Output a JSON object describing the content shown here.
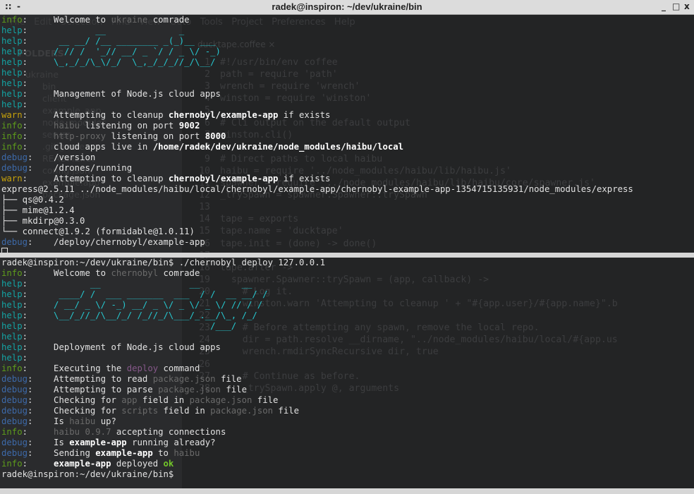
{
  "window": {
    "title": "radek@inspiron: ~/dev/ukraine/bin",
    "menu_icon": "::",
    "left_minimize": "-",
    "controls": [
      "_",
      "□",
      "x"
    ]
  },
  "background_editor": {
    "menu": "File   Edit   Selection   Find   View   Goto   Tools   Project   Preferences   Help",
    "sidebar_header": "FOLDERS",
    "sidebar_items": [
      "ukraine",
      "bin",
      "client",
      "example_app",
      "node_modules",
      "server",
      ".gitignore",
      "README.rst",
      "config.json",
      "example.app",
      "package.json"
    ],
    "tab": "ducktape.coffee        ×",
    "code": [
      [
        "1",
        "#!/usr/bin/env coffee"
      ],
      [
        "2",
        "path = require 'path'"
      ],
      [
        "3",
        "wrench = require 'wrench'"
      ],
      [
        "4",
        "winston = require 'winston'"
      ],
      [
        "5",
        ""
      ],
      [
        "6",
        "# Cli output on the default output"
      ],
      [
        "7",
        "winston.cli()"
      ],
      [
        "8",
        ""
      ],
      [
        "9",
        "# Direct paths to local haibu"
      ],
      [
        "10",
        "haibu = require '../node_modules/haibu/lib/haibu.js'"
      ],
      [
        "11",
        "spawner = require '../node_modules/haibu/lib/haibu/core/spawner.js'"
      ],
      [
        "12",
        "_trySpawn = spawner.Spawner::trySpawn"
      ],
      [
        "13",
        ""
      ],
      [
        "14",
        "tape = exports"
      ],
      [
        "15",
        "tape.name = 'ducktape'"
      ],
      [
        "16",
        "tape.init = (done) -> done()"
      ],
      [
        "17",
        ""
      ],
      [
        "18",
        "tape.after ->"
      ],
      [
        "19",
        "  spawner.Spawner::trySpawn = (app, callback) ->"
      ],
      [
        "20",
        "    # Log it."
      ],
      [
        "21",
        "    winston.warn 'Attempting to cleanup ' + \"#{app.user}/#{app.name}\".b"
      ],
      [
        "22",
        ""
      ],
      [
        "23",
        "    # Before attempting any spawn, remove the local repo."
      ],
      [
        "24",
        "    dir = path.resolve __dirname, \"../node_modules/haibu/local/#{app.us"
      ],
      [
        "25",
        "    wrench.rmdirSyncRecursive dir, true"
      ],
      [
        "26",
        ""
      ],
      [
        "27",
        "    # Continue as before."
      ],
      [
        "28",
        "    _trySpawn.apply @, arguments"
      ]
    ]
  },
  "top_pane": [
    [
      [
        "info",
        "i"
      ],
      [
        ":     Welcome to ",
        "t"
      ],
      [
        "ukraine",
        "g"
      ],
      [
        " comrade",
        "t"
      ]
    ],
    [
      [
        "help",
        "h"
      ],
      [
        ":",
        "t"
      ],
      [
        "             __              _",
        "a"
      ]
    ],
    [
      [
        "help",
        "h"
      ],
      [
        ":",
        "t"
      ],
      [
        "      __ __/ /__ ________ _(_)__ ___",
        "a"
      ]
    ],
    [
      [
        "help",
        "h"
      ],
      [
        ":",
        "t"
      ],
      [
        "     / // /  '_// __/ _ `/ / _ \\/ -_)",
        "a"
      ]
    ],
    [
      [
        "help",
        "h"
      ],
      [
        ":",
        "t"
      ],
      [
        "     \\_,_/_/\\_\\/_/  \\_,_/_/_//_/\\__/",
        "a"
      ]
    ],
    [
      [
        "help",
        "h"
      ],
      [
        ":",
        "t"
      ]
    ],
    [
      [
        "help",
        "h"
      ],
      [
        ":",
        "t"
      ]
    ],
    [
      [
        "help",
        "h"
      ],
      [
        ":     Management of Node.js cloud apps",
        "t"
      ]
    ],
    [
      [
        "help",
        "h"
      ],
      [
        ":",
        "t"
      ]
    ],
    [
      [
        "warn",
        "w"
      ],
      [
        ":     Attempting to cleanup ",
        "t"
      ],
      [
        "chernobyl/example-app",
        "b"
      ],
      [
        " if exists",
        "t"
      ]
    ],
    [
      [
        "info",
        "i"
      ],
      [
        ":     ",
        "t"
      ],
      [
        "haibu",
        "g"
      ],
      [
        " listening on port ",
        "t"
      ],
      [
        "9002",
        "b"
      ]
    ],
    [
      [
        "info",
        "i"
      ],
      [
        ":     ",
        "t"
      ],
      [
        "http-proxy",
        "g"
      ],
      [
        " listening on port ",
        "t"
      ],
      [
        "8000",
        "b"
      ]
    ],
    [
      [
        "info",
        "i"
      ],
      [
        ":     cloud apps live in ",
        "t"
      ],
      [
        "/home/radek/dev/ukraine/node_modules/haibu/local",
        "b"
      ]
    ],
    [
      [
        "debug",
        "d"
      ],
      [
        ":    /version",
        "t"
      ]
    ],
    [
      [
        "debug",
        "d"
      ],
      [
        ":    /drones/running",
        "t"
      ]
    ],
    [
      [
        "warn",
        "w"
      ],
      [
        ":     Attempting to cleanup ",
        "t"
      ],
      [
        "chernobyl/example-app",
        "b"
      ],
      [
        " if exists",
        "t"
      ]
    ],
    [
      [
        "express@2.5.11 ../node_modules/haibu/local/chernobyl/example-app/chernobyl-example-app-1354715135931/node_modules/express",
        "t"
      ]
    ],
    [
      [
        "├── qs@0.4.2",
        "t"
      ]
    ],
    [
      [
        "├── mime@1.2.4",
        "t"
      ]
    ],
    [
      [
        "├── mkdirp@0.3.0",
        "t"
      ]
    ],
    [
      [
        "└── connect@1.9.2 (formidable@1.0.11)",
        "t"
      ]
    ],
    [
      [
        "debug",
        "d"
      ],
      [
        ":    /deploy/chernobyl/example-app",
        "t"
      ]
    ],
    [
      [
        "__cursor__",
        "t"
      ]
    ]
  ],
  "bottom_pane": [
    [
      [
        "radek@inspiron:~/dev/ukraine/bin$ ./chernobyl deploy 127.0.0.1",
        "t"
      ]
    ],
    [
      [
        "info",
        "i"
      ],
      [
        ":     Welcome to ",
        "t"
      ],
      [
        "chernobyl",
        "g"
      ],
      [
        " comrade",
        "t"
      ]
    ],
    [
      [
        "help",
        "h"
      ],
      [
        ":",
        "t"
      ],
      [
        "            __                 __        __",
        "a"
      ]
    ],
    [
      [
        "help",
        "h"
      ],
      [
        ":",
        "t"
      ],
      [
        "      ____/ /  ___ _______  ___  / /  __ __/ /",
        "a"
      ]
    ],
    [
      [
        "help",
        "h"
      ],
      [
        ":",
        "t"
      ],
      [
        "     / __/ _ \\/ -_) __/ _ \\/ _ \\/ _ \\/ // / /",
        "a"
      ]
    ],
    [
      [
        "help",
        "h"
      ],
      [
        ":",
        "t"
      ],
      [
        "     \\__/_//_/\\__/_/ /_//_/\\___/_.__/\\_, /_/",
        "a"
      ]
    ],
    [
      [
        "help",
        "h"
      ],
      [
        ":",
        "t"
      ],
      [
        "                                   /___/",
        "a"
      ]
    ],
    [
      [
        "help",
        "h"
      ],
      [
        ":",
        "t"
      ]
    ],
    [
      [
        "help",
        "h"
      ],
      [
        ":     Deployment of Node.js cloud apps",
        "t"
      ]
    ],
    [
      [
        "help",
        "h"
      ],
      [
        ":",
        "t"
      ]
    ],
    [
      [
        "info",
        "i"
      ],
      [
        ":     Executing the ",
        "t"
      ],
      [
        "deploy",
        "p"
      ],
      [
        " command",
        "t"
      ]
    ],
    [
      [
        "debug",
        "d"
      ],
      [
        ":    Attempting to read ",
        "t"
      ],
      [
        "package.json",
        "g"
      ],
      [
        " file",
        "t"
      ]
    ],
    [
      [
        "debug",
        "d"
      ],
      [
        ":    Attempting to parse ",
        "t"
      ],
      [
        "package.json",
        "g"
      ],
      [
        " file",
        "t"
      ]
    ],
    [
      [
        "debug",
        "d"
      ],
      [
        ":    Checking for ",
        "t"
      ],
      [
        "app",
        "g"
      ],
      [
        " field in ",
        "t"
      ],
      [
        "package.json",
        "g"
      ],
      [
        " file",
        "t"
      ]
    ],
    [
      [
        "debug",
        "d"
      ],
      [
        ":    Checking for ",
        "t"
      ],
      [
        "scripts",
        "g"
      ],
      [
        " field in ",
        "t"
      ],
      [
        "package.json",
        "g"
      ],
      [
        " file",
        "t"
      ]
    ],
    [
      [
        "debug",
        "d"
      ],
      [
        ":    Is ",
        "t"
      ],
      [
        "haibu",
        "g"
      ],
      [
        " up?",
        "t"
      ]
    ],
    [
      [
        "info",
        "i"
      ],
      [
        ":     ",
        "t"
      ],
      [
        "haibu 0.9.7",
        "g"
      ],
      [
        " accepting connections",
        "t"
      ]
    ],
    [
      [
        "debug",
        "d"
      ],
      [
        ":    Is ",
        "t"
      ],
      [
        "example-app",
        "b"
      ],
      [
        " running already?",
        "t"
      ]
    ],
    [
      [
        "debug",
        "d"
      ],
      [
        ":    Sending ",
        "t"
      ],
      [
        "example-app",
        "b"
      ],
      [
        " to ",
        "t"
      ],
      [
        "haibu",
        "g"
      ]
    ],
    [
      [
        "info",
        "i"
      ],
      [
        ":     ",
        "t"
      ],
      [
        "example-app",
        "b"
      ],
      [
        " deployed ",
        "t"
      ],
      [
        "ok",
        "o"
      ]
    ],
    [
      [
        "radek@inspiron:~/dev/ukraine/bin$",
        "t"
      ]
    ]
  ]
}
